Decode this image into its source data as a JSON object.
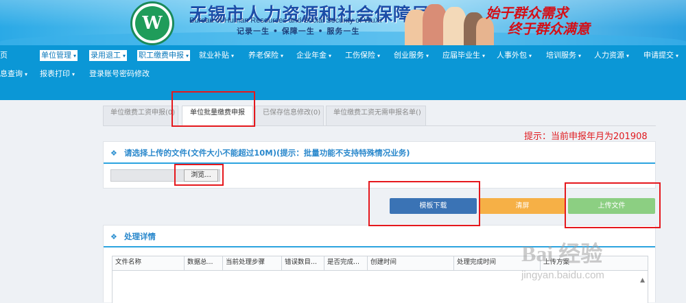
{
  "banner": {
    "title_cn": "无锡市人力资源和社会保障局",
    "title_en": "Bureau of Human Resources and Social Security of WuXi",
    "motto": "记录一生 • 保障一生 • 服务一生",
    "logo_letter": "W",
    "slogan_line1": "始于群众需求",
    "slogan_line2": "终于群众满意"
  },
  "nav": {
    "row1": [
      {
        "label": "页",
        "caret": ""
      },
      {
        "label": "单位管理",
        "caret": "▾"
      },
      {
        "label": "录用退工",
        "caret": "▾"
      },
      {
        "label": "职工缴费申报",
        "caret": "▾"
      },
      {
        "label": "就业补贴",
        "caret": "▾"
      },
      {
        "label": "养老保险",
        "caret": "▾"
      },
      {
        "label": "企业年金",
        "caret": "▾"
      },
      {
        "label": "工伤保险",
        "caret": "▾"
      },
      {
        "label": "创业服务",
        "caret": "▾"
      },
      {
        "label": "应届毕业生",
        "caret": "▾"
      },
      {
        "label": "人事外包",
        "caret": "▾"
      },
      {
        "label": "培训服务",
        "caret": "▾"
      },
      {
        "label": "人力资源",
        "caret": "▾"
      },
      {
        "label": "申请提交",
        "caret": "▾"
      }
    ],
    "row2": [
      {
        "label": "息查询",
        "caret": "▾"
      },
      {
        "label": "报表打印",
        "caret": "▾"
      },
      {
        "label": "登录账号密码修改",
        "caret": ""
      }
    ]
  },
  "tabs": [
    {
      "label": "单位缴费工资申报(0)"
    },
    {
      "label": "单位批量缴费申报"
    },
    {
      "label": "已保存信息修改(0)"
    },
    {
      "label": "单位缴费工资无需申报名单()"
    }
  ],
  "hint": "提示：当前申报年月为201908",
  "upload_section": {
    "title": "请选择上传的文件(文件大小不能超过10M)(提示：批量功能不支持特殊情况业务)",
    "browse_label": "浏览..."
  },
  "actions": {
    "template_label": "模板下载",
    "clear_label": "清屏",
    "upload_label": "上传文件"
  },
  "details": {
    "title": "处理详情",
    "columns": [
      "文件名称",
      "数据总...",
      "当前处理步骤",
      "错误数目...",
      "是否完成...",
      "创建时间",
      "处理完成时间",
      "上传方案"
    ]
  },
  "colors": {
    "nav_bg": "#0b97d6",
    "accent": "#2aa3df",
    "btn_template": "#3a73b5",
    "btn_clear": "#f6b046",
    "btn_upload": "#8ccf82",
    "hint_red": "#e0191e"
  },
  "watermark": {
    "main": "Bai 经验",
    "sub": "jingyan.baidu.com"
  }
}
